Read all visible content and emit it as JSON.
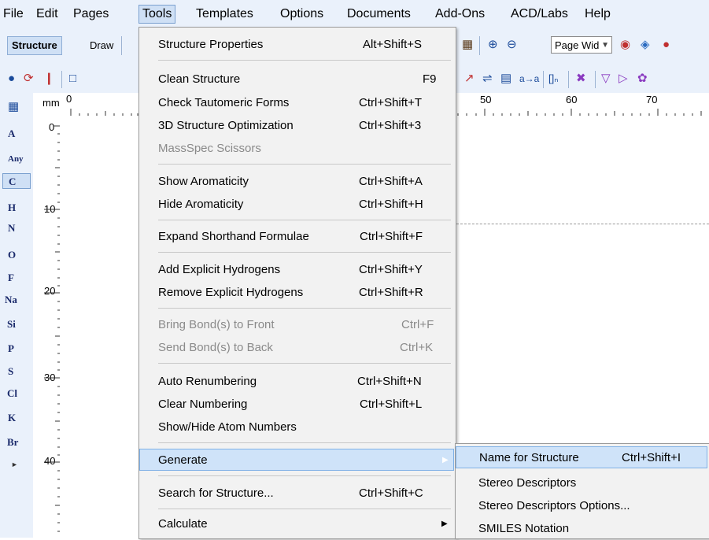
{
  "menubar": {
    "items": [
      "File",
      "Edit",
      "Pages",
      "Tools",
      "Templates",
      "Options",
      "Documents",
      "Add-Ons",
      "ACD/Labs",
      "Help"
    ]
  },
  "toolbar": {
    "structure_tab": "Structure",
    "draw_tab": "Draw",
    "zoom_value": "Page Wid"
  },
  "ruler": {
    "unit": "mm",
    "top_ticks": [
      "0",
      "50",
      "60",
      "70"
    ],
    "left_ticks": [
      "0",
      "10",
      "20",
      "30",
      "40"
    ]
  },
  "palette": {
    "elements": [
      "A",
      "Any",
      "C",
      "H",
      "N",
      "O",
      "F",
      "Na",
      "Si",
      "P",
      "S",
      "Cl",
      "K",
      "Br"
    ],
    "selected": "C"
  },
  "tools_menu": {
    "items": [
      {
        "label": "Structure Properties",
        "shortcut": "Alt+Shift+S"
      },
      {
        "label": "Clean Structure",
        "shortcut": "F9"
      },
      {
        "label": "Check Tautomeric Forms",
        "shortcut": "Ctrl+Shift+T"
      },
      {
        "label": "3D Structure Optimization",
        "shortcut": "Ctrl+Shift+3"
      },
      {
        "label": "MassSpec Scissors",
        "shortcut": "",
        "disabled": true
      },
      {
        "label": "Show Aromaticity",
        "shortcut": "Ctrl+Shift+A"
      },
      {
        "label": "Hide Aromaticity",
        "shortcut": "Ctrl+Shift+H"
      },
      {
        "label": "Expand Shorthand Formulae",
        "shortcut": "Ctrl+Shift+F"
      },
      {
        "label": "Add Explicit Hydrogens",
        "shortcut": "Ctrl+Shift+Y"
      },
      {
        "label": "Remove Explicit Hydrogens",
        "shortcut": "Ctrl+Shift+R"
      },
      {
        "label": "Bring Bond(s) to Front",
        "shortcut": "Ctrl+F",
        "disabled": true
      },
      {
        "label": "Send Bond(s) to Back",
        "shortcut": "Ctrl+K",
        "disabled": true
      },
      {
        "label": "Auto Renumbering",
        "shortcut": "Ctrl+Shift+N"
      },
      {
        "label": "Clear Numbering",
        "shortcut": "Ctrl+Shift+L"
      },
      {
        "label": "Show/Hide Atom Numbers",
        "shortcut": ""
      },
      {
        "label": "Generate",
        "shortcut": "",
        "submenu": true,
        "highlighted": true
      },
      {
        "label": "Search for Structure...",
        "shortcut": "Ctrl+Shift+C"
      },
      {
        "label": "Calculate",
        "shortcut": "",
        "submenu": true
      }
    ]
  },
  "generate_menu": {
    "items": [
      {
        "label": "Name for Structure",
        "shortcut": "Ctrl+Shift+I",
        "highlighted": true
      },
      {
        "label": "Stereo Descriptors",
        "shortcut": ""
      },
      {
        "label": "Stereo Descriptors Options...",
        "shortcut": ""
      },
      {
        "label": "SMILES Notation",
        "shortcut": ""
      }
    ]
  },
  "colors": {
    "toolbar_bg": "#eaf1fb",
    "menu_bg": "#f2f2f2",
    "highlight": "#cfe3f9",
    "disabled_text": "#8a8a8a"
  }
}
